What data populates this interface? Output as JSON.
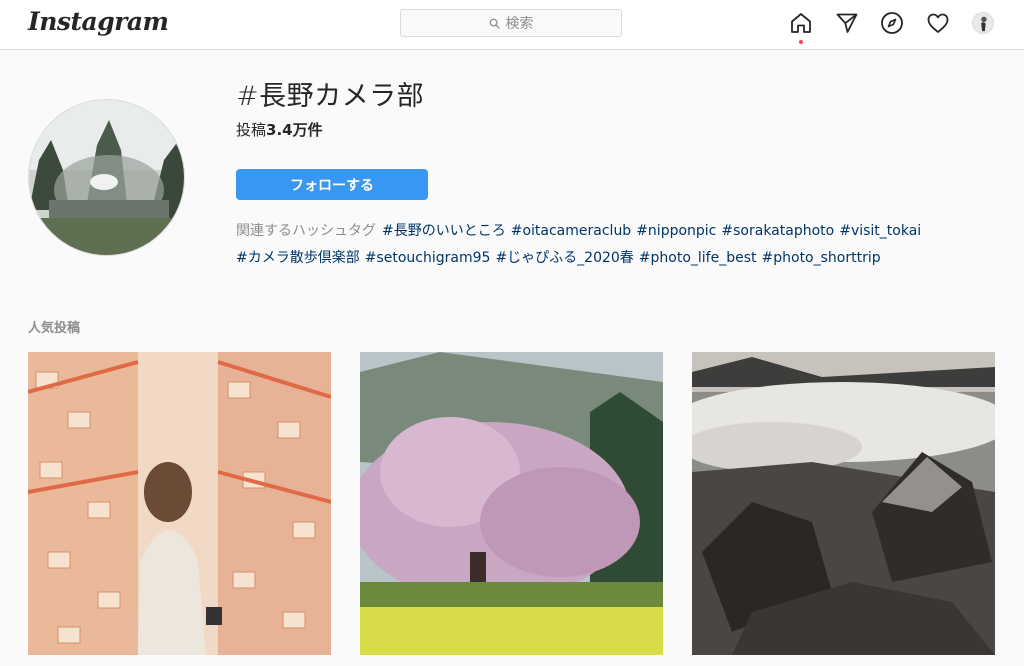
{
  "nav": {
    "logo": "Instagram",
    "search_placeholder": "検索",
    "icons": [
      "home-icon",
      "direct-icon",
      "explore-icon",
      "activity-icon",
      "profile-avatar"
    ]
  },
  "hashtag_header": {
    "title": "#長野カメラ部",
    "posts_label": "投稿",
    "posts_count": "3.4万件",
    "follow_button": "フォローする",
    "related_label": "関連するハッシュタグ",
    "related_tags": [
      "#長野のいいところ",
      "#oitacameraclub",
      "#nipponpic",
      "#sorakataphoto",
      "#visit_tokai",
      "#カメラ散歩倶楽部",
      "#setouchigram95",
      "#じゃぴふる_2020春",
      "#photo_life_best",
      "#photo_shorttrip"
    ]
  },
  "top_posts": {
    "label": "人気投稿",
    "items": [
      "shrine-ema-portrait-photo",
      "cherry-blossom-tree-photo",
      "sea-of-clouds-rocks-photo"
    ]
  },
  "colors": {
    "follow_button": "#3897f0",
    "hashtag_link": "#003569",
    "notification_dot": "#ed4956"
  }
}
